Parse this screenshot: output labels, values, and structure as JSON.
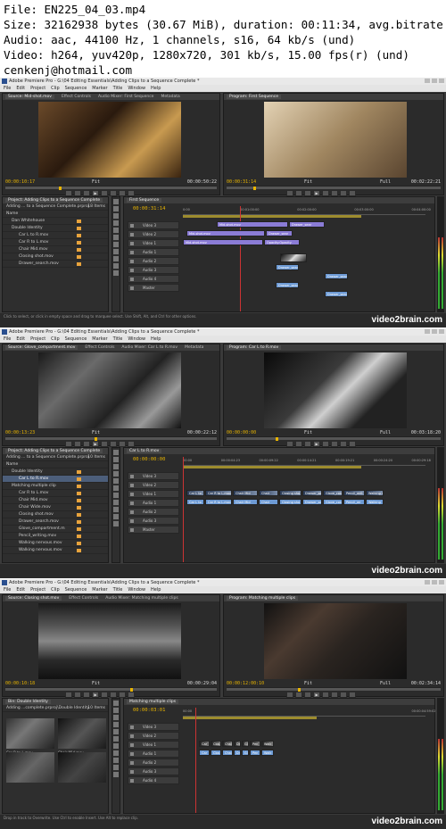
{
  "meta": {
    "file": "File: EN225_04_03.mp4",
    "size": "Size: 32162938 bytes (30.67 MiB), duration: 00:11:34, avg.bitrate: 371",
    "audio": "Audio: aac, 44100 Hz, 1 channels, s16, 64 kb/s (und)",
    "video": "Video: h264, yuv420p, 1280x720, 301 kb/s, 15.00 fps(r) (und)",
    "email": "cenkenj@hotmail.com"
  },
  "menu": [
    "File",
    "Edit",
    "Project",
    "Clip",
    "Sequence",
    "Marker",
    "Title",
    "Window",
    "Help"
  ],
  "watermark": "video2brain.com",
  "frames": [
    {
      "title": "Adobe Premiere Pro - G:\\04 Editing Essentials\\Adding Clips to a Sequence Complete *",
      "source_tabs": [
        "Source: Mid-shot.mov",
        "Effect Controls",
        "Audio Mixer: First Sequence",
        "Metadata"
      ],
      "program_tab": "Program: First Sequence",
      "src_tc_in": "00:00:10:17",
      "src_tc_out": "00:00:50:22",
      "prg_tc_in": "00:00:31:14",
      "prg_tc_out": "00:02:22:21",
      "fit": "Fit",
      "full": "Full",
      "project_title": "Project: Adding Clips to a Sequence Complete",
      "project_sub": "Adding ... to a Sequence Complete.prproj",
      "project_items": "18 Items",
      "project_rows": [
        "Name",
        "Dan Whitehouse",
        "Double Identity",
        "Car L to R.mov",
        "Car R to L.mov",
        "Chair Mid.mov",
        "Closing shot.mov",
        "Drawer_search.mov"
      ],
      "timeline_tab": "First Sequence",
      "timeline_tc": "00:00:31:14",
      "ruler": [
        "0:00",
        "00:01:00:00",
        "00:02:00:00",
        "00:03:00:00",
        "00:04:00:00"
      ],
      "tracks": [
        "Video 3",
        "Video 2",
        "Video 1",
        "Audio 1",
        "Audio 2",
        "Audio 3",
        "Audio 4",
        "Master"
      ],
      "clips_v3": [
        "Mid-shot.mov",
        "Drawer_sear"
      ],
      "clips_v2": [
        "Mid-shot.mov",
        "Drawer_sear"
      ],
      "clips_v1": [
        "Mid-shot.mov",
        "Opacity:Opacity"
      ],
      "clips_a": [
        "Drawer_sear",
        "Drawer_sear",
        "Drawer_sear",
        "Drawer_sear"
      ],
      "status": "Click to select, or click in empty space and drag to marquee select. Use Shift, Alt, and Ctrl for other options."
    },
    {
      "title": "Adobe Premiere Pro - G:\\04 Editing Essentials\\Adding Clips to a Sequence Complete *",
      "source_tabs": [
        "Source: Glove_compartment.mov",
        "Effect Controls",
        "Audio Mixer: Car L to R.mov",
        "Metadata"
      ],
      "program_tab": "Program: Car L to R.mov",
      "src_tc_in": "00:00:13:23",
      "src_tc_out": "00:00:22:12",
      "prg_tc_in": "00:00:00:00",
      "prg_tc_out": "00:03:18:20",
      "fit": "Fit",
      "full": "Full",
      "project_title": "Project: Adding Clips to a Sequence Complete",
      "project_sub": "Adding ... to a Sequence Complete.prproj",
      "project_items": "10 Items",
      "project_rows": [
        "Name",
        "Double Identity",
        "Car L to R.mov",
        "Matching multiple clip",
        "Car R to L.mov",
        "Chair Mid.mov",
        "Chair Wide.mov",
        "Closing shot.mov",
        "Drawer_search.mov",
        "Glove_compartment.m",
        "Pencil_writing.mov",
        "Walking nervous.mov",
        "Walking nervous.mov"
      ],
      "timeline_tab": "Car L to R.mov",
      "timeline_tc": "00:00:00:00",
      "ruler": [
        "00:00",
        "00:00:04:23",
        "00:00:09:22",
        "00:00:14:21",
        "00:00:19:21",
        "00:00:24:20",
        "00:00:29:18"
      ],
      "tracks": [
        "Video 3",
        "Video 2",
        "Video 1",
        "Audio 1",
        "Audio 2",
        "Audio 3",
        "Master"
      ],
      "clips_v1": [
        "Car L to",
        "Car R to L.mov",
        "Chair Mid",
        "Chair",
        "Closing sho",
        "Drawer_se",
        "Glove_con",
        "Pencil_writ",
        "Walking n"
      ],
      "clips_a": [
        "Car L to",
        "Car R to L.mov",
        "Chair Mid",
        "Chair",
        "Closing sho",
        "Drawer_se",
        "Glove_con",
        "Pencil_wr",
        "Walking"
      ],
      "status": ""
    },
    {
      "title": "Adobe Premiere Pro - G:\\04 Editing Essentials\\Adding Clips to a Sequence Complete *",
      "source_tabs": [
        "Source: Closing shot.mov",
        "Effect Controls",
        "Audio Mixer: Matching multiple clips"
      ],
      "program_tab": "Program: Matching multiple clips",
      "src_tc_in": "00:00:10:18",
      "src_tc_out": "00:00:29:04",
      "prg_tc_in": "00:00:12:00:10",
      "prg_tc_out": "00:02:34:14",
      "fit": "Fit",
      "full": "Full",
      "project_title": "Bin: Double Identity",
      "project_sub": "Adding ...complete.prproj\\Double Identity",
      "project_items": "10 Items",
      "thumbs": [
        "Car R to L.mov",
        "Chair Mid.mov",
        "",
        ""
      ],
      "timeline_tab": "Matching multiple clips",
      "timeline_tc": "00:00:03:01",
      "ruler": [
        "00:00",
        "00:00:04:59:02"
      ],
      "tracks": [
        "Video 3",
        "Video 2",
        "Video 1",
        "Audio 1",
        "Audio 2",
        "Audio 3",
        "Audio 4"
      ],
      "clips_v1": [
        "Car",
        "Clos",
        "Chai",
        "Dr",
        "Gl",
        "Pen",
        "Walk"
      ],
      "clips_a": [
        "Car",
        "Clos",
        "Chai",
        "Dr",
        "Gl",
        "Pen",
        "Walk"
      ],
      "status": "Drop in track to Overwrite. Use Ctrl to enable Insert. Use Alt to replace clip."
    }
  ]
}
